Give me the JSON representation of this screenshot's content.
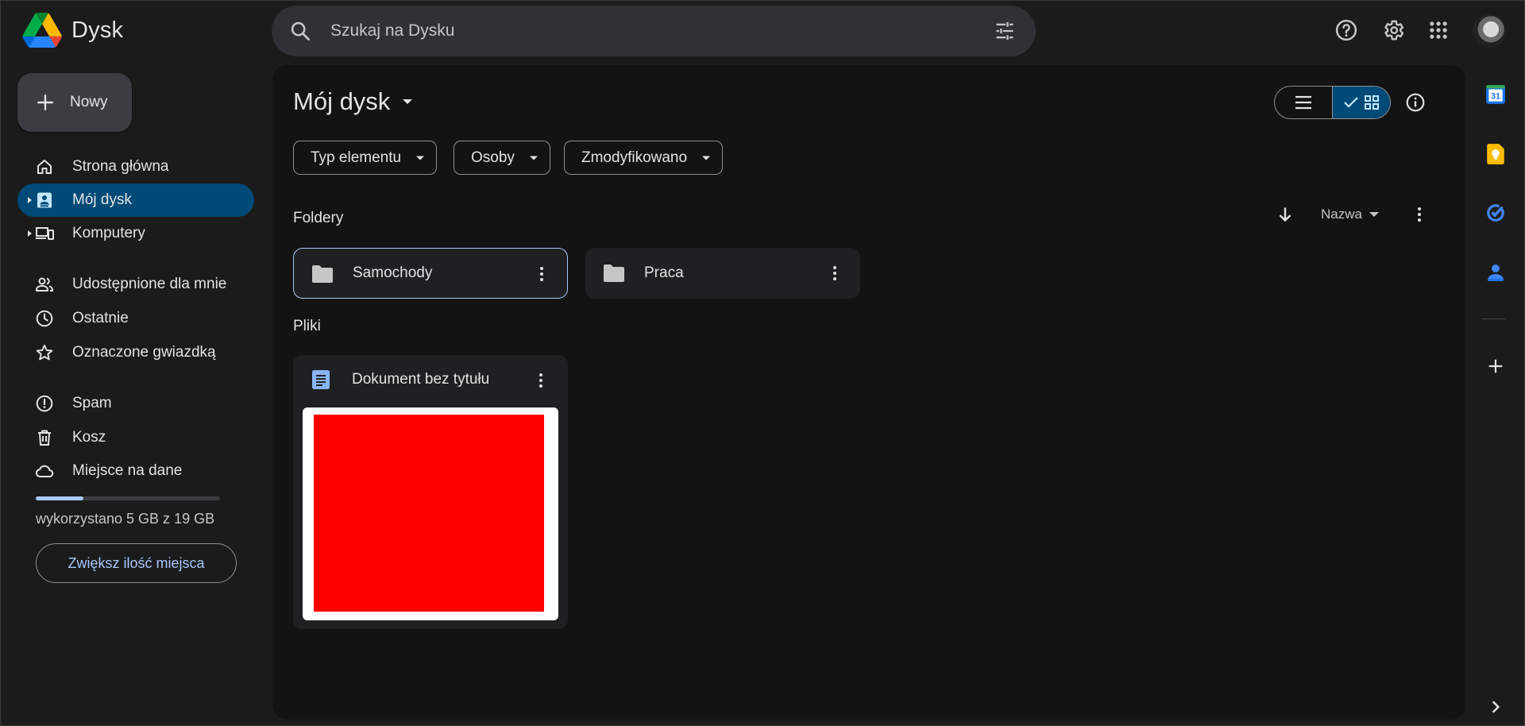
{
  "app": {
    "name": "Dysk"
  },
  "search": {
    "placeholder": "Szukaj na Dysku"
  },
  "sidebar": {
    "new_button": "Nowy",
    "items": [
      {
        "label": "Strona główna",
        "icon": "home-icon"
      },
      {
        "label": "Mój dysk",
        "icon": "my-drive-icon",
        "active": true
      },
      {
        "label": "Komputery",
        "icon": "computers-icon"
      },
      {
        "label": "Udostępnione dla mnie",
        "icon": "shared-icon"
      },
      {
        "label": "Ostatnie",
        "icon": "clock-icon"
      },
      {
        "label": "Oznaczone gwiazdką",
        "icon": "star-icon"
      },
      {
        "label": "Spam",
        "icon": "spam-icon"
      },
      {
        "label": "Kosz",
        "icon": "trash-icon"
      },
      {
        "label": "Miejsce na dane",
        "icon": "cloud-icon"
      }
    ],
    "storage": {
      "text": "wykorzystano 5 GB z 19 GB",
      "used_fraction": 0.26
    },
    "upgrade_button": "Zwiększ ilość miejsca"
  },
  "main": {
    "title": "Mój dysk",
    "filters": [
      "Typ elementu",
      "Osoby",
      "Zmodyfikowano"
    ],
    "folders_label": "Foldery",
    "files_label": "Pliki",
    "sort": {
      "label": "Nazwa",
      "direction": "descending"
    },
    "folders": [
      {
        "name": "Samochody",
        "selected": true
      },
      {
        "name": "Praca",
        "selected": false
      }
    ],
    "files": [
      {
        "name": "Dokument bez tytułu",
        "type": "google-doc",
        "thumbnail_color": "#ff0000"
      }
    ]
  },
  "colors": {
    "background": "#1b1b1b",
    "panel": "#131314",
    "accent_active": "#004a77",
    "accent_text": "#a8c7fa"
  }
}
